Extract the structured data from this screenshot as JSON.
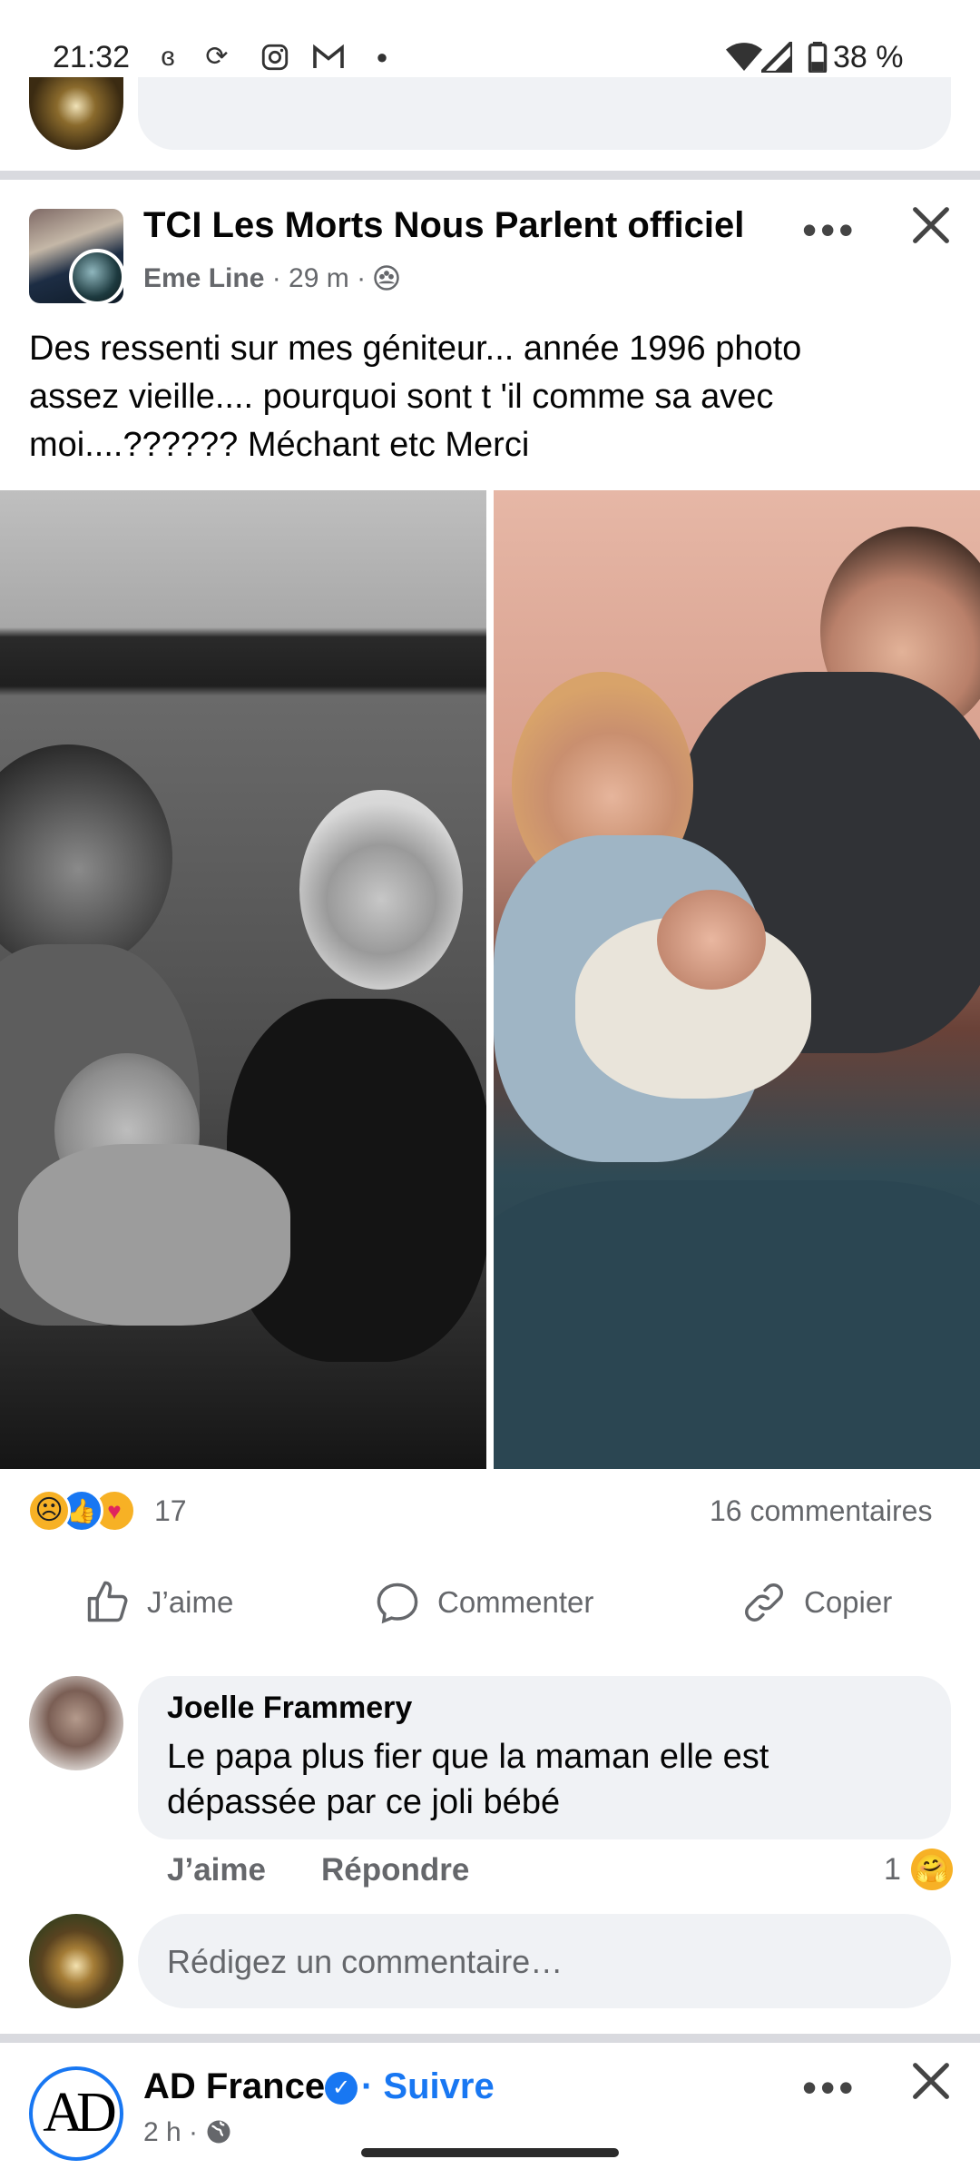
{
  "status_bar": {
    "time": "21:32",
    "battery": "38 %",
    "notification_icons": [
      "app-icon",
      "sync-icon",
      "instagram-icon",
      "gmail-icon",
      "dot-icon"
    ]
  },
  "post": {
    "page_name": "TCI Les Morts Nous Parlent officiel",
    "author": "Eme Line",
    "meta": "· 29 m ·",
    "privacy_icon": "group-icon",
    "text": "Des ressenti sur mes géniteur... année 1996 photo\nassez vieille.... pourquoi sont t 'il comme sa avec\nmoi....?????? Méchant etc  Merci",
    "reactions": {
      "count": "17",
      "types": [
        "sad",
        "like",
        "care"
      ]
    },
    "comments_count": "16 commentaires",
    "actions": {
      "like": "J’aime",
      "comment": "Commenter",
      "copy": "Copier"
    }
  },
  "comment": {
    "author": "Joelle Frammery",
    "text": "Le papa plus fier que la maman elle est\ndépassée par ce joli bébé",
    "like": "J’aime",
    "reply": "Répondre",
    "reaction_count": "1"
  },
  "compose": {
    "placeholder": "Rédigez un commentaire…"
  },
  "next_post": {
    "logo_text": "AD",
    "name": "AD France",
    "follow": "· Suivre",
    "time": "2 h ·"
  },
  "colors": {
    "accent": "#1877f2",
    "secondary_text": "#65676b",
    "bubble": "#f0f2f5"
  }
}
